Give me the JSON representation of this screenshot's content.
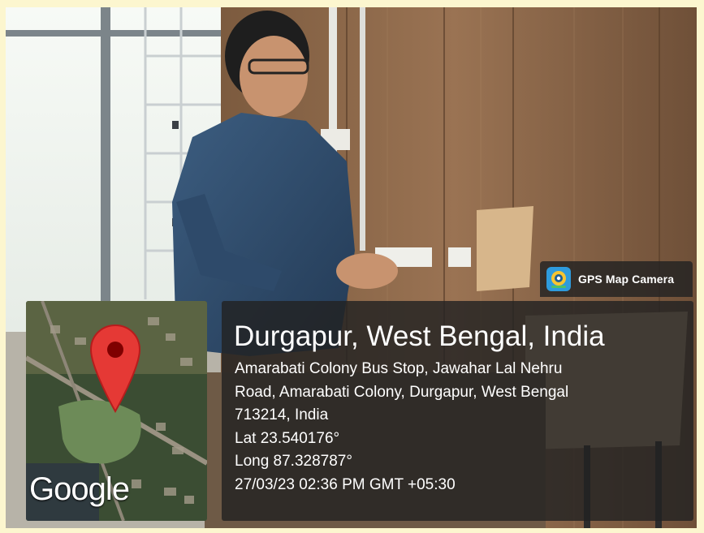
{
  "badge": {
    "label": "GPS Map Camera",
    "icon": "gps-map-camera-app-icon"
  },
  "map": {
    "brand": "Google",
    "marker_color": "#e53935",
    "marker_icon": "map-pin-icon"
  },
  "location": {
    "city": "Durgapur, West Bengal, India",
    "address_line_1": "Amarabati Colony Bus Stop, Jawahar Lal Nehru",
    "address_line_2": "Road, Amarabati Colony, Durgapur, West Bengal",
    "address_line_3": "713214, India",
    "latitude": "Lat 23.540176°",
    "longitude": "Long 87.328787°",
    "timestamp": "27/03/23 02:36 PM GMT +05:30"
  }
}
